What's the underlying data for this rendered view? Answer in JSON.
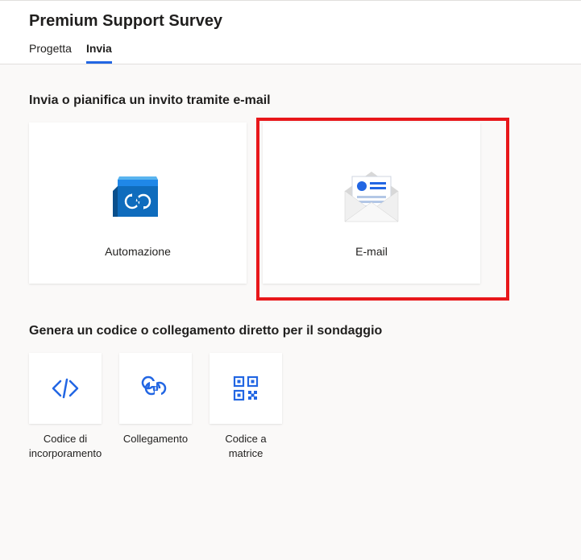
{
  "header": {
    "title": "Premium Support Survey",
    "tabs": [
      {
        "label": "Progetta"
      },
      {
        "label": "Invia"
      }
    ]
  },
  "section1": {
    "title": "Invia o pianifica un invito tramite e-mail",
    "cards": [
      {
        "label": "Automazione"
      },
      {
        "label": "E-mail"
      }
    ]
  },
  "section2": {
    "title": "Genera un codice o collegamento diretto per il sondaggio",
    "cards": [
      {
        "label": "Codice di incorporamento"
      },
      {
        "label": "Collegamento"
      },
      {
        "label": "Codice a matrice"
      }
    ]
  }
}
